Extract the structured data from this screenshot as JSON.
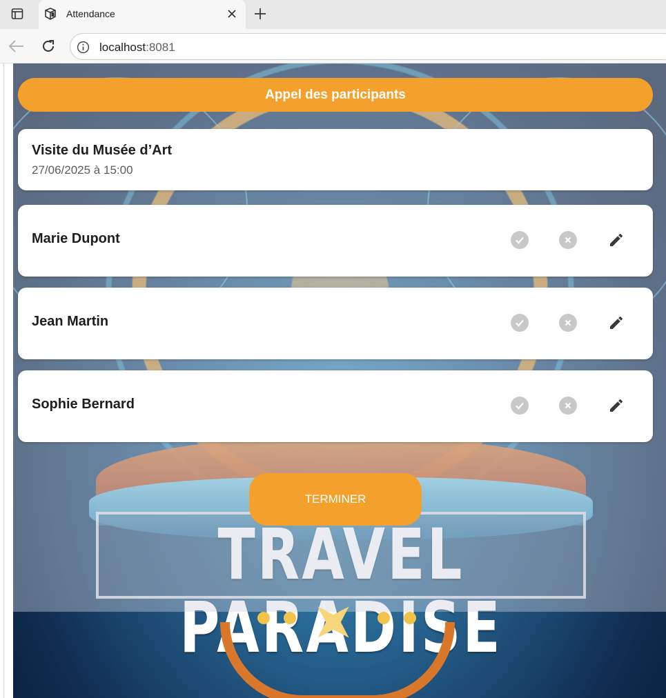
{
  "browser": {
    "tab_title": "Attendance",
    "url_host": "localhost",
    "url_port": ":8081"
  },
  "app": {
    "header_title": "Appel des participants",
    "event": {
      "title": "Visite du Musée d’Art",
      "datetime": "27/06/2025 à 15:00"
    },
    "participants": [
      {
        "name": "Marie Dupont"
      },
      {
        "name": "Jean Martin"
      },
      {
        "name": "Sophie Bernard"
      }
    ],
    "finish_label": "TERMINER",
    "background_logo_text": "TRAVEL PARADISE"
  },
  "icons": {
    "present": "check-circle-icon",
    "absent": "x-circle-icon",
    "edit": "pencil-icon"
  },
  "colors": {
    "accent": "#f4a02d",
    "icon_inactive": "#c8c8c8",
    "icon_active_dark": "#3a3a3a"
  }
}
